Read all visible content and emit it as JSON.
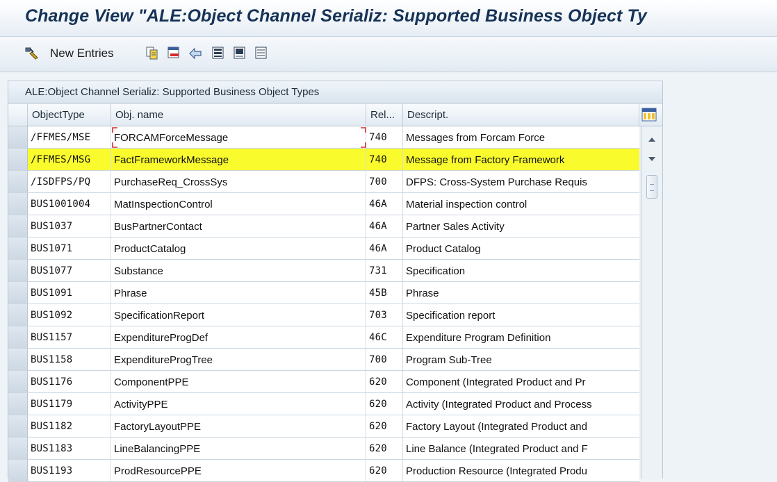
{
  "window": {
    "title": "Change View \"ALE:Object Channel Serializ: Supported Business Object Ty"
  },
  "toolbar": {
    "new_entries_label": "New Entries",
    "icons": [
      "glasses-icon",
      "copy-icon",
      "delete-icon",
      "undo-icon",
      "select-all-icon",
      "select-block-icon",
      "deselect-all-icon"
    ]
  },
  "panel": {
    "title": "ALE:Object Channel Serializ: Supported Business Object Types"
  },
  "table": {
    "columns": [
      "ObjectType",
      "Obj. name",
      "Rel...",
      "Descript."
    ],
    "rows": [
      {
        "type": "/FFMES/MSE",
        "name": "FORCAMForceMessage",
        "rel": "740",
        "desc": "Messages from Forcam Force"
      },
      {
        "type": "/FFMES/MSG",
        "name": "FactFrameworkMessage",
        "rel": "740",
        "desc": "Message from Factory Framework"
      },
      {
        "type": "/ISDFPS/PQ",
        "name": "PurchaseReq_CrossSys",
        "rel": "700",
        "desc": "DFPS: Cross-System Purchase Requis"
      },
      {
        "type": "BUS1001004",
        "name": "MatInspectionControl",
        "rel": "46A",
        "desc": "Material inspection control"
      },
      {
        "type": "BUS1037",
        "name": "BusPartnerContact",
        "rel": "46A",
        "desc": "Partner Sales Activity"
      },
      {
        "type": "BUS1071",
        "name": "ProductCatalog",
        "rel": "46A",
        "desc": "Product Catalog"
      },
      {
        "type": "BUS1077",
        "name": "Substance",
        "rel": "731",
        "desc": "Specification"
      },
      {
        "type": "BUS1091",
        "name": "Phrase",
        "rel": "45B",
        "desc": "Phrase"
      },
      {
        "type": "BUS1092",
        "name": "SpecificationReport",
        "rel": "703",
        "desc": "Specification report"
      },
      {
        "type": "BUS1157",
        "name": "ExpenditureProgDef",
        "rel": "46C",
        "desc": "Expenditure Program Definition"
      },
      {
        "type": "BUS1158",
        "name": "ExpenditureProgTree",
        "rel": "700",
        "desc": "Program Sub-Tree"
      },
      {
        "type": "BUS1176",
        "name": "ComponentPPE",
        "rel": "620",
        "desc": "Component (Integrated Product and Pr"
      },
      {
        "type": "BUS1179",
        "name": "ActivityPPE",
        "rel": "620",
        "desc": "Activity (Integrated Product and Process"
      },
      {
        "type": "BUS1182",
        "name": "FactoryLayoutPPE",
        "rel": "620",
        "desc": "Factory Layout (Integrated Product and"
      },
      {
        "type": "BUS1183",
        "name": "LineBalancingPPE",
        "rel": "620",
        "desc": "Line Balance (Integrated Product and F"
      },
      {
        "type": "BUS1193",
        "name": "ProdResourcePPE",
        "rel": "620",
        "desc": "Production Resource (Integrated Produ"
      }
    ]
  },
  "colors": {
    "highlight": "#fafb2c",
    "title_text": "#163357",
    "panel_bg": "#e9f0f7"
  }
}
